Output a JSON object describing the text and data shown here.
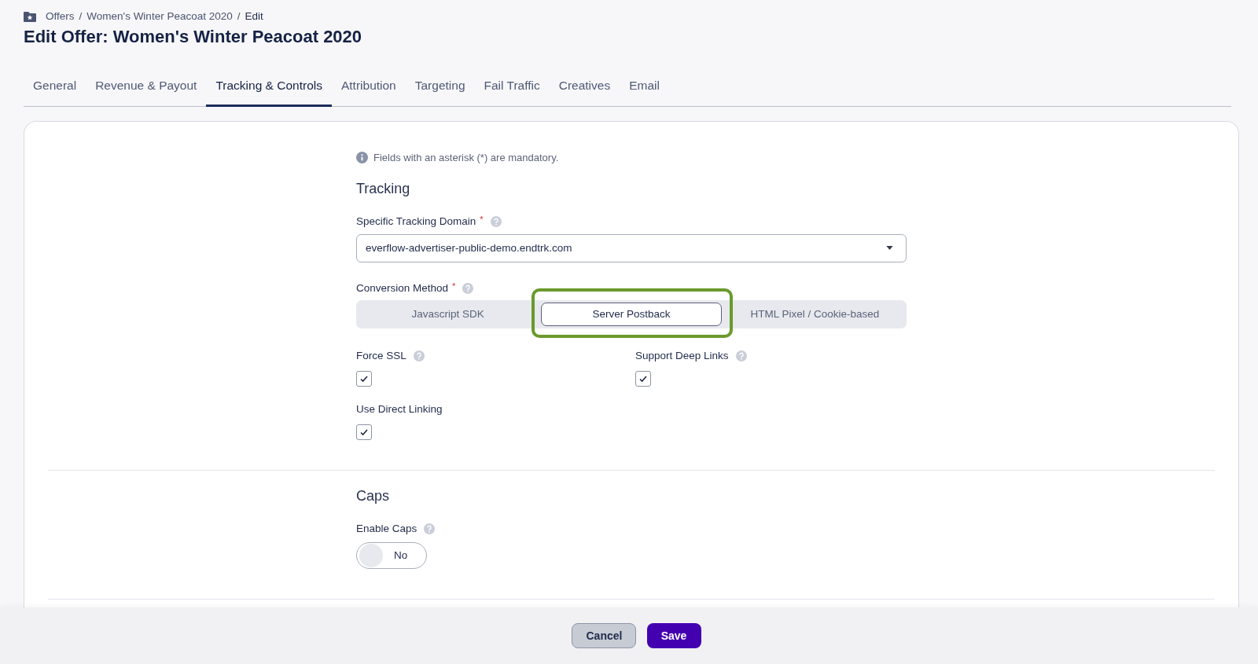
{
  "breadcrumb": [
    "Offers",
    "Women's Winter Peacoat 2020",
    "Edit"
  ],
  "breadcrumb_separator": "/",
  "title": "Edit Offer: Women's Winter Peacoat 2020",
  "tabs": [
    {
      "label": "General",
      "selected": false
    },
    {
      "label": "Revenue & Payout",
      "selected": false
    },
    {
      "label": "Tracking & Controls",
      "selected": true
    },
    {
      "label": "Attribution",
      "selected": false
    },
    {
      "label": "Targeting",
      "selected": false
    },
    {
      "label": "Fail Traffic",
      "selected": false
    },
    {
      "label": "Creatives",
      "selected": false
    },
    {
      "label": "Email",
      "selected": false
    }
  ],
  "notice": "Fields with an asterisk (*) are mandatory.",
  "tracking": {
    "heading": "Tracking",
    "domain": {
      "label": "Specific Tracking Domain",
      "required_mark": "*",
      "value": "everflow-advertiser-public-demo.endtrk.com"
    },
    "conversion_method": {
      "label": "Conversion Method",
      "required_mark": "*",
      "options": [
        {
          "label": "Javascript SDK",
          "selected": false,
          "highlighted": false
        },
        {
          "label": "Server Postback",
          "selected": true,
          "highlighted": true
        },
        {
          "label": "HTML Pixel / Cookie-based",
          "selected": false,
          "highlighted": false
        }
      ]
    },
    "checkboxes": [
      {
        "label": "Force SSL",
        "checked": true,
        "help": true
      },
      {
        "label": "Support Deep Links",
        "checked": true,
        "help": true
      },
      {
        "label": "Use Direct Linking",
        "checked": true,
        "help": false
      }
    ]
  },
  "caps": {
    "heading": "Caps",
    "toggle": {
      "label": "Enable Caps",
      "on": false,
      "value": "No"
    }
  },
  "buttons": [
    {
      "label": "Cancel",
      "kind": "secondary"
    },
    {
      "label": "Save",
      "kind": "primary"
    }
  ]
}
